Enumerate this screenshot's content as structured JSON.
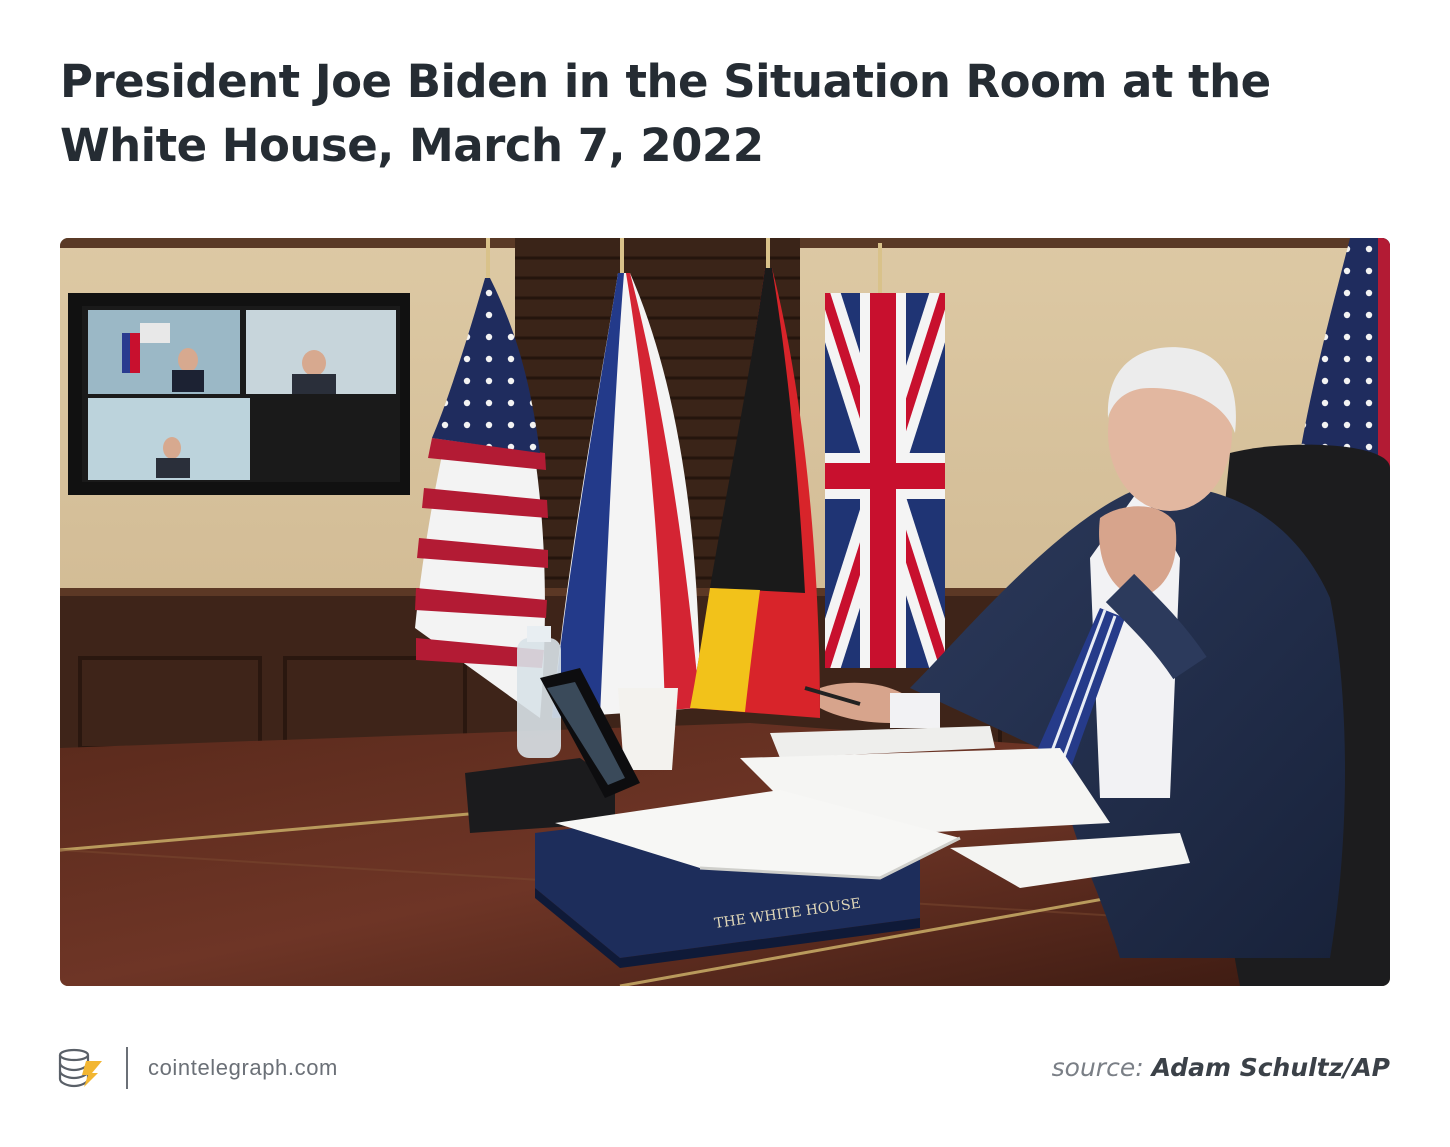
{
  "header": {
    "title": "President Joe Biden in the Situation Room at the White House, March 7, 2022"
  },
  "photo": {
    "book_label": "THE WHITE HOUSE"
  },
  "footer": {
    "logo_icon": "cointelegraph-logo-icon",
    "brand": "cointelegraph.com",
    "source_label": "source:",
    "source_value": "Adam Schultz/AP"
  },
  "colors": {
    "title": "#252c33",
    "muted": "#7a7f86",
    "accent": "#f2b632"
  }
}
